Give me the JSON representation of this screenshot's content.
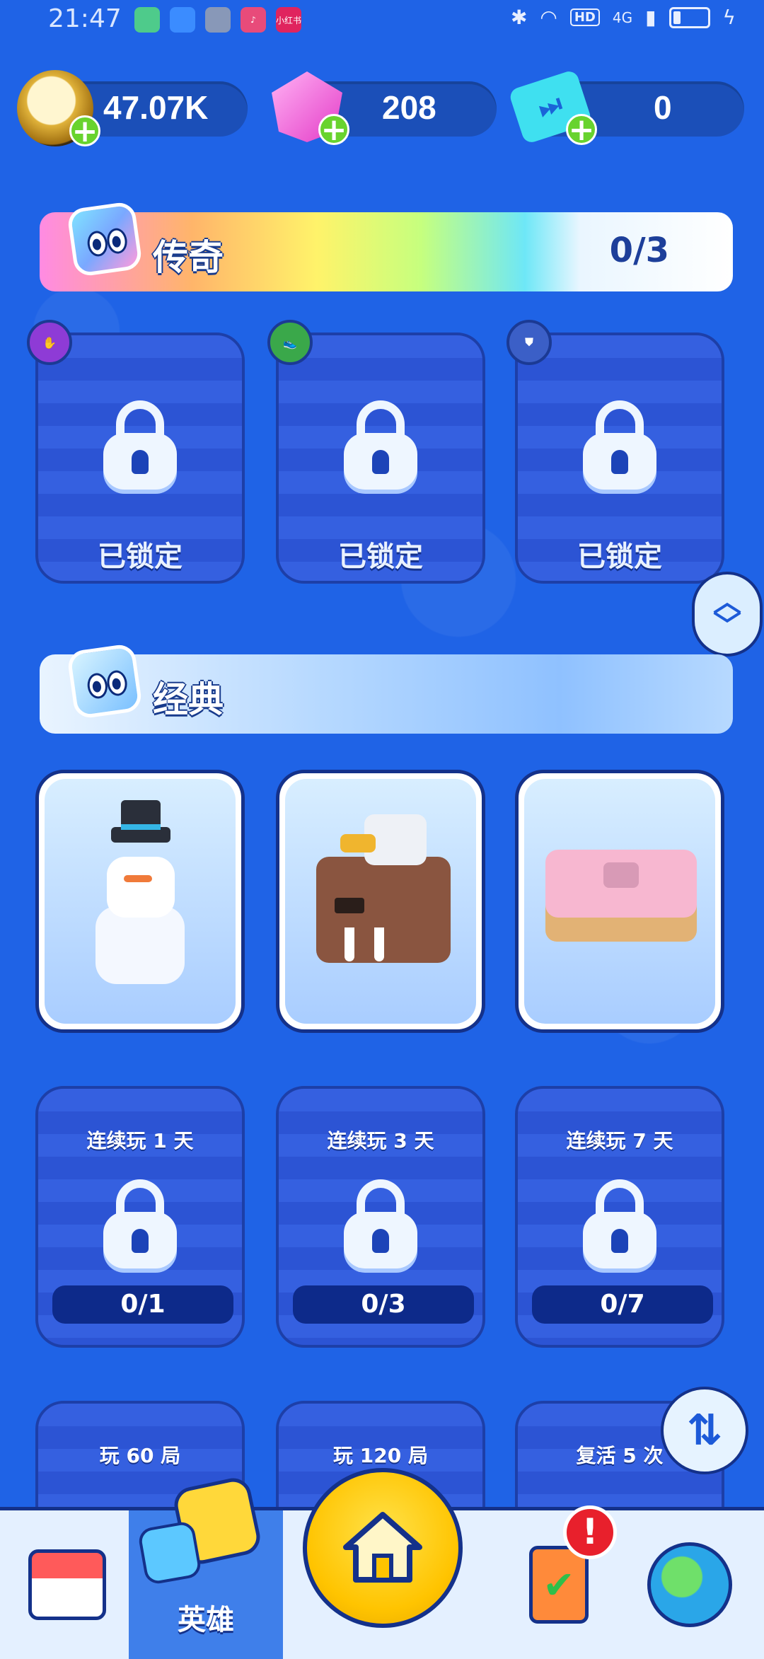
{
  "status_bar": {
    "time": "21:47",
    "app_icons": [
      {
        "name": "app-green-icon",
        "color": "#4ecb8b"
      },
      {
        "name": "app-blue-folder-icon",
        "color": "#3b8cff"
      },
      {
        "name": "app-gray-icon",
        "color": "#8898b8"
      },
      {
        "name": "music-app-icon",
        "color": "#e84b7a"
      },
      {
        "name": "xiaohongshu-app-icon",
        "color": "#e0245e",
        "text": "小红书"
      }
    ],
    "network": "4G",
    "hd_label": "HD"
  },
  "currencies": {
    "coins": "47.07K",
    "gems": "208",
    "tickets": "0"
  },
  "legend_section": {
    "title": "传奇",
    "progress": "0/3",
    "cards": [
      {
        "label": "已锁定",
        "badge": "hand-icon",
        "badge_color": "#8e3bd6"
      },
      {
        "label": "已锁定",
        "badge": "boot-icon",
        "badge_color": "#3aa84a"
      },
      {
        "label": "已锁定",
        "badge": "shield-icon",
        "badge_color": "#3b5fc7"
      }
    ]
  },
  "classic_section": {
    "title": "经典",
    "heroes": [
      {
        "name": "snowman-hero"
      },
      {
        "name": "walrus-eagle-hero"
      },
      {
        "name": "donut-hero"
      }
    ],
    "streak_cards": [
      {
        "title": "连续玩 1 天",
        "progress": "0/1"
      },
      {
        "title": "连续玩 3 天",
        "progress": "0/3"
      },
      {
        "title": "连续玩 7 天",
        "progress": "0/7"
      }
    ],
    "more_cards": [
      {
        "title": "玩 60 局"
      },
      {
        "title": "玩 120 局"
      },
      {
        "title": "复活 5 次"
      }
    ]
  },
  "bottom_nav": {
    "heroes_label": "英雄",
    "alert": "!"
  }
}
